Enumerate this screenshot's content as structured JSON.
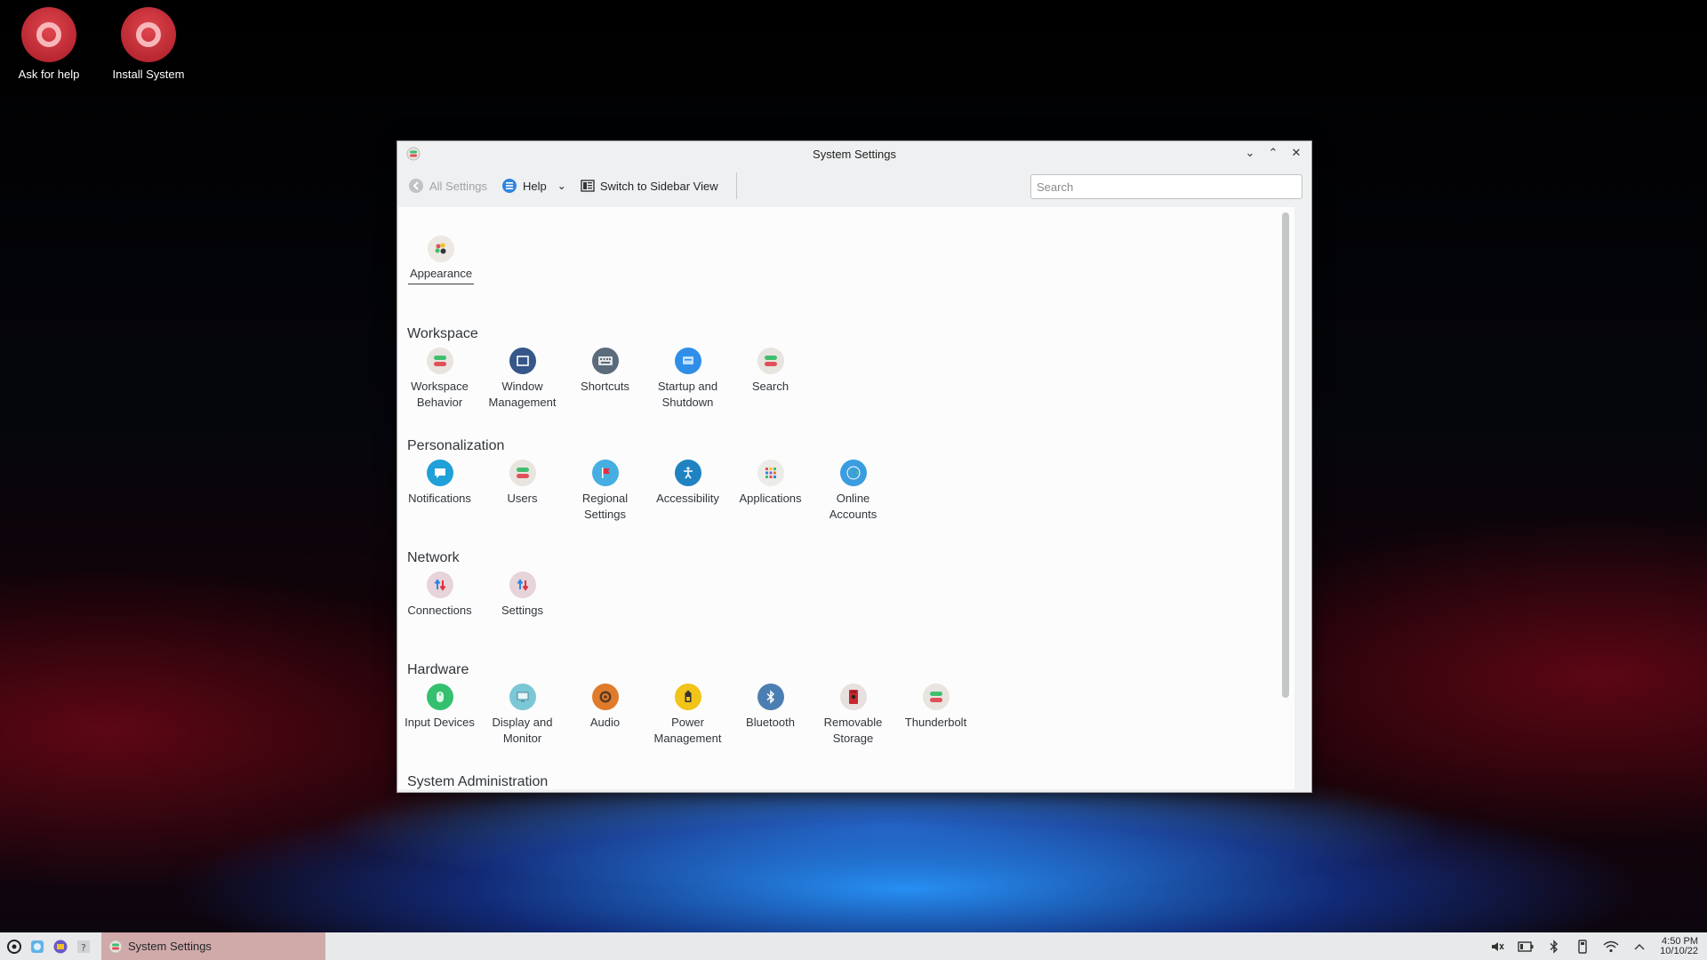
{
  "desktop": {
    "icons": [
      {
        "label": "Ask for help"
      },
      {
        "label": "Install System"
      }
    ]
  },
  "window": {
    "title": "System Settings",
    "toolbar": {
      "all_settings": "All Settings",
      "help": "Help",
      "sidebar_view": "Switch to Sidebar View",
      "search_placeholder": "Search"
    },
    "top_item": {
      "label": "Appearance",
      "icon": "appearance-icon"
    },
    "sections": [
      {
        "title": "Workspace",
        "items": [
          {
            "label": "Workspace\nBehavior",
            "icon": "toggle-icon",
            "color": "#e8e4df"
          },
          {
            "label": "Window\nManagement",
            "icon": "window-icon",
            "color": "#35578a"
          },
          {
            "label": "Shortcuts",
            "icon": "keyboard-icon",
            "color": "#5a6b7b"
          },
          {
            "label": "Startup and\nShutdown",
            "icon": "startup-icon",
            "color": "#2f8ee8"
          },
          {
            "label": "Search",
            "icon": "toggle-icon",
            "color": "#e8e4df"
          }
        ]
      },
      {
        "title": "Personalization",
        "items": [
          {
            "label": "Notifications",
            "icon": "chat-bubble-icon",
            "color": "#1fa0d8"
          },
          {
            "label": "Users",
            "icon": "toggle-icon",
            "color": "#e8e4df"
          },
          {
            "label": "Regional\nSettings",
            "icon": "flag-icon",
            "color": "#46aee0"
          },
          {
            "label": "Accessibility",
            "icon": "accessibility-icon",
            "color": "#1f83c2"
          },
          {
            "label": "Applications",
            "icon": "grid-icon",
            "color": "#ecebe8"
          },
          {
            "label": "Online\nAccounts",
            "icon": "globe-icon",
            "color": "#3b9de0"
          }
        ]
      },
      {
        "title": "Network",
        "items": [
          {
            "label": "Connections",
            "icon": "arrows-icon",
            "color": "#e6d4da"
          },
          {
            "label": "Settings",
            "icon": "arrows-icon",
            "color": "#e6d4da"
          }
        ]
      },
      {
        "title": "Hardware",
        "items": [
          {
            "label": "Input Devices",
            "icon": "mouse-icon",
            "color": "#34c06e"
          },
          {
            "label": "Display and\nMonitor",
            "icon": "monitor-icon",
            "color": "#7cc7d6"
          },
          {
            "label": "Audio",
            "icon": "speaker-icon",
            "color": "#e07b2c"
          },
          {
            "label": "Power\nManagement",
            "icon": "battery-icon",
            "color": "#f2c318"
          },
          {
            "label": "Bluetooth",
            "icon": "bluetooth-icon",
            "color": "#4b7fb3"
          },
          {
            "label": "Removable\nStorage",
            "icon": "storage-icon",
            "color": "#e6e0de"
          },
          {
            "label": "Thunderbolt",
            "icon": "toggle-icon",
            "color": "#e8e4df"
          }
        ]
      },
      {
        "title": "System Administration",
        "items": []
      }
    ]
  },
  "taskbar": {
    "task_label": "System Settings",
    "clock_time": "4:50 PM",
    "clock_date": "10/10/22"
  }
}
